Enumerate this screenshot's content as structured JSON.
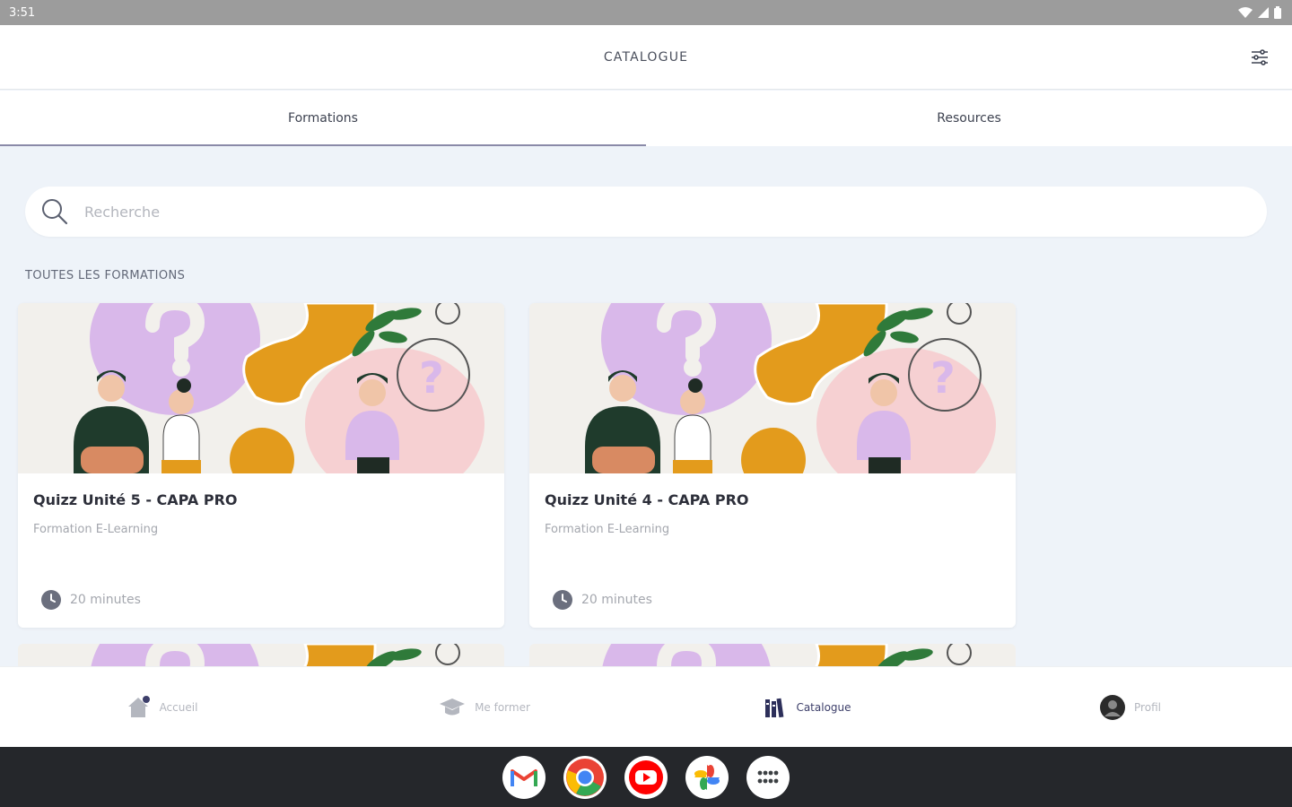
{
  "status_bar": {
    "time": "3:51"
  },
  "header": {
    "title": "CATALOGUE",
    "filter_icon": "sliders-icon"
  },
  "tabs": [
    {
      "label": "Formations",
      "active": true
    },
    {
      "label": "Resources",
      "active": false
    }
  ],
  "search": {
    "placeholder": "Recherche",
    "value": ""
  },
  "section_title": "TOUTES LES FORMATIONS",
  "cards": [
    {
      "title": "Quizz Unité 5 - CAPA PRO",
      "subtitle": "Formation E-Learning",
      "duration": "20 minutes"
    },
    {
      "title": "Quizz Unité 4 - CAPA PRO",
      "subtitle": "Formation E-Learning",
      "duration": "20 minutes"
    }
  ],
  "bottom_nav": [
    {
      "label": "Accueil",
      "icon": "home-icon",
      "active": false
    },
    {
      "label": "Me former",
      "icon": "graduation-cap-icon",
      "active": false
    },
    {
      "label": "Catalogue",
      "icon": "library-icon",
      "active": true
    },
    {
      "label": "Profil",
      "icon": "avatar-icon",
      "active": false
    }
  ],
  "dock": [
    {
      "name": "Gmail",
      "icon": "gmail-icon"
    },
    {
      "name": "Chrome",
      "icon": "chrome-icon"
    },
    {
      "name": "YouTube",
      "icon": "youtube-icon"
    },
    {
      "name": "Photos",
      "icon": "photos-icon"
    },
    {
      "name": "Apps",
      "icon": "app-grid-icon"
    }
  ],
  "colors": {
    "background": "#eef3f9",
    "accent": "#3d3f6a",
    "illustration_purple": "#d9b8ea",
    "illustration_orange": "#e39b1c",
    "illustration_pink": "#f6d0d2",
    "illustration_green": "#2f7a3a"
  }
}
